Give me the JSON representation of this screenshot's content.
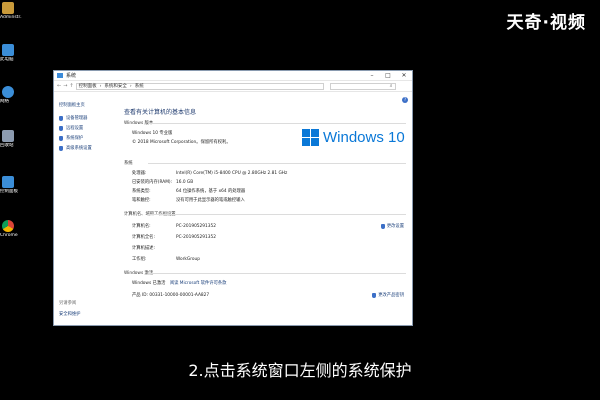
{
  "watermark": "天奇·视频",
  "subtitle": "2.点击系统窗口左侧的系统保护",
  "desktop": {
    "icons": [
      {
        "label": "Adminstr...",
        "color": "#c99a3a"
      },
      {
        "label": "此电脑",
        "color": "#3b8ed8"
      },
      {
        "label": "网络",
        "color": "#3b8ed8"
      },
      {
        "label": "回收站",
        "color": "#8c9bb0"
      },
      {
        "label": "控制面板",
        "color": "#3b8ed8"
      },
      {
        "label": "Chrome",
        "color": "#db4437"
      }
    ]
  },
  "window": {
    "title": "系统",
    "breadcrumb": [
      "控制面板",
      "系统和安全",
      "系统"
    ],
    "left": {
      "home": "控制面板主页",
      "links": [
        "设备管理器",
        "远程设置",
        "系统保护",
        "高级系统设置"
      ],
      "see_also": "另请参阅",
      "security": "安全和维护"
    },
    "main": {
      "page_title": "查看有关计算机的基本信息",
      "edition_header": "Windows 版本",
      "edition": "Windows 10 专业版",
      "copyright": "© 2018 Microsoft Corporation。保留所有权利。",
      "logo_text": "Windows 10",
      "system_header": "系统",
      "system_rows": [
        {
          "k": "处理器:",
          "v": "Intel(R) Core(TM) i5-8400 CPU @ 2.80GHz   2.81 GHz"
        },
        {
          "k": "已安装的内存(RAM):",
          "v": "16.0 GB"
        },
        {
          "k": "系统类型:",
          "v": "64 位操作系统，基于 x64 的处理器"
        },
        {
          "k": "笔和触控:",
          "v": "没有可用于此显示器的笔或触控输入"
        }
      ],
      "computer_header": "计算机名、域和工作组设置",
      "computer_rows": [
        {
          "k": "计算机名:",
          "v": "PC-201905291352"
        },
        {
          "k": "计算机全名:",
          "v": "PC-201905291352"
        },
        {
          "k": "计算机描述:",
          "v": ""
        },
        {
          "k": "工作组:",
          "v": "WorkGroup"
        }
      ],
      "change_settings": "更改设置",
      "activation_header": "Windows 激活",
      "activation_status": "Windows 已激活",
      "license_link": "阅读 Microsoft 软件许可条款",
      "product_id": "产品 ID: 00331-10000-00001-AA827",
      "change_key": "更改产品密钥"
    }
  }
}
